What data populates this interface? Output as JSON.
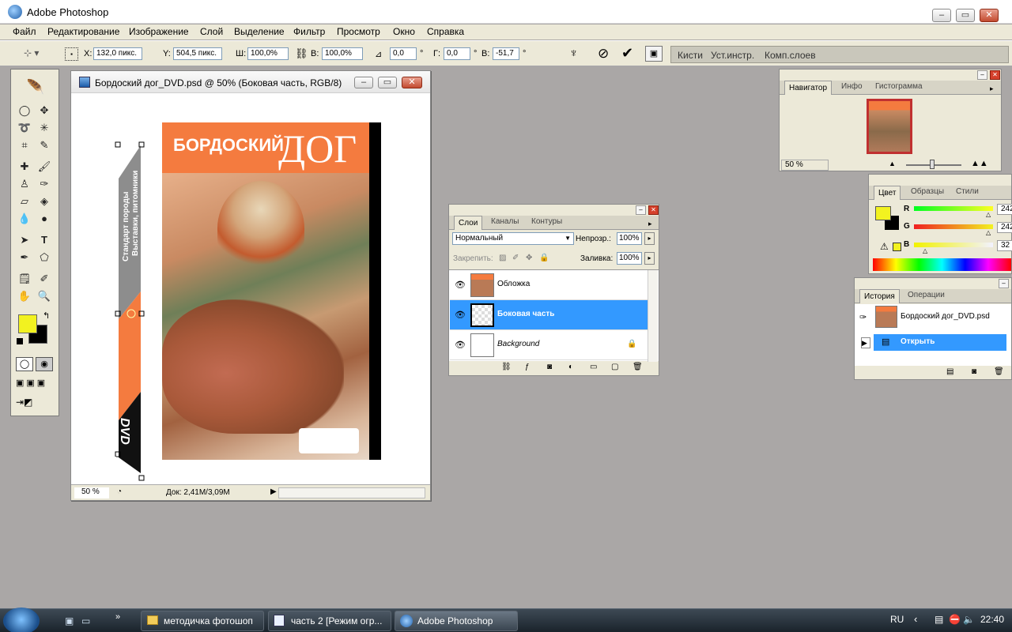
{
  "window": {
    "title": "Adobe Photoshop"
  },
  "menu": [
    "Файл",
    "Редактирование",
    "Изображение",
    "Слой",
    "Выделение",
    "Фильтр",
    "Просмотр",
    "Окно",
    "Справка"
  ],
  "options": {
    "x_label": "X:",
    "x_value": "132,0 пикс.",
    "y_label": "Y:",
    "y_value": "504,5 пикс.",
    "w_label": "Ш:",
    "w_value": "100,0%",
    "h_label": "В:",
    "h_value": "100,0%",
    "angle_value": "0,0",
    "angle_unit": "°",
    "hskew_label": "Г:",
    "hskew_value": "0,0",
    "hskew_unit": "°",
    "vskew_label": "В:",
    "vskew_value": "-51,7",
    "vskew_unit": "°",
    "well_tabs": [
      "Кисти",
      "Уст.инстр.",
      "Комп.слоев"
    ]
  },
  "document": {
    "title": "Бордоский дог_DVD.psd @ 50% (Боковая часть, RGB/8)",
    "zoom": "50 %",
    "doc_info": "Док: 2,41M/3,09M",
    "cover_title_small": "БОРДОСКИЙ",
    "cover_title_big": "ДОГ",
    "spine_text1": "Стандарт породы",
    "spine_text2": "Выставки, питомники",
    "spine_title": "БОРДОСКИЙ ДОГ",
    "spine_dvd": "DVD"
  },
  "navigator": {
    "tabs": [
      "Навигатор",
      "Инфо",
      "Гистограмма"
    ],
    "zoom": "50 %"
  },
  "color": {
    "tabs": [
      "Цвет",
      "Образцы",
      "Стили"
    ],
    "r_label": "R",
    "g_label": "G",
    "b_label": "B",
    "r_value": "242",
    "g_value": "242",
    "b_value": "32",
    "fg": "#f2f220",
    "bg": "#000000"
  },
  "layers": {
    "tabs": [
      "Слои",
      "Каналы",
      "Контуры"
    ],
    "blend_mode": "Нормальный",
    "opacity_label": "Непрозр.:",
    "opacity_value": "100%",
    "lock_label": "Закрепить:",
    "fill_label": "Заливка:",
    "fill_value": "100%",
    "items": [
      {
        "name": "Обложка"
      },
      {
        "name": "Боковая часть"
      },
      {
        "name": "Background"
      }
    ]
  },
  "history": {
    "tabs": [
      "История",
      "Операции"
    ],
    "snapshot": "Бордоский дог_DVD.psd",
    "items": [
      "Открыть"
    ]
  },
  "taskbar": {
    "items": [
      "методичка фотошоп",
      "часть 2 [Режим огр...",
      "Adobe Photoshop"
    ],
    "lang": "RU",
    "time": "22:40"
  },
  "colors": {
    "accent": "#3399ff",
    "cover_orange": "#f47b3f",
    "fg_swatch": "#f2f220"
  }
}
